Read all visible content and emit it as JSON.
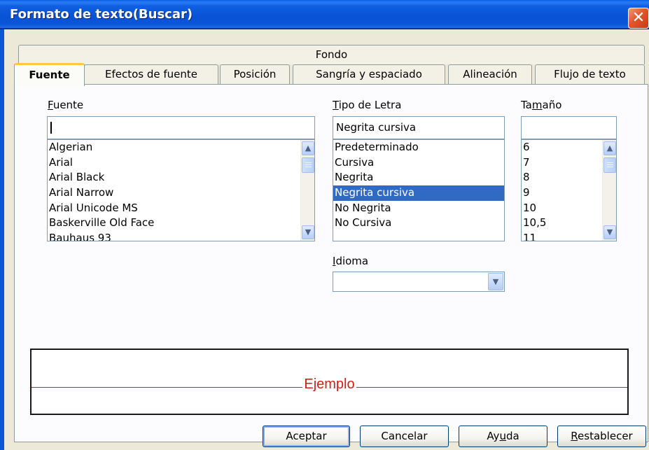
{
  "window": {
    "title": "Formato de texto(Buscar)",
    "close_glyph": "✕"
  },
  "tabs": {
    "row1": [
      "Fondo"
    ],
    "row2": [
      "Fuente",
      "Efectos de fuente",
      "Posición",
      "Sangría y espaciado",
      "Alineación",
      "Flujo de texto"
    ],
    "active": "Fuente"
  },
  "font": {
    "label_mnemonic": "F",
    "label_rest": "uente",
    "value": "",
    "items": [
      "Algerian",
      "Arial",
      "Arial Black",
      "Arial Narrow",
      "Arial Unicode MS",
      "Baskerville Old Face",
      "Bauhaus 93"
    ]
  },
  "style": {
    "label_mnemonic": "T",
    "label_rest": "ipo de Letra",
    "value": "Negrita cursiva",
    "items": [
      "Predeterminado",
      "Cursiva",
      "Negrita",
      "Negrita cursiva",
      "No Negrita",
      "No Cursiva"
    ],
    "selected_index": 3
  },
  "size": {
    "label_pre": "Ta",
    "label_mnemonic": "m",
    "label_rest": "año",
    "value": "",
    "items": [
      "6",
      "7",
      "8",
      "9",
      "10",
      "10,5",
      "11"
    ]
  },
  "language": {
    "label_mnemonic": "I",
    "label_rest": "dioma",
    "value": ""
  },
  "preview": {
    "text": "Ejemplo"
  },
  "buttons": {
    "ok": "Aceptar",
    "cancel": "Cancelar",
    "help_pre": "Ay",
    "help_mnemonic": "u",
    "help_rest": "da",
    "reset_mnemonic": "R",
    "reset_rest": "establecer"
  },
  "colors": {
    "selection": "#316ac5",
    "preview_text": "#d21f14",
    "titlebar": "#0852d6"
  }
}
